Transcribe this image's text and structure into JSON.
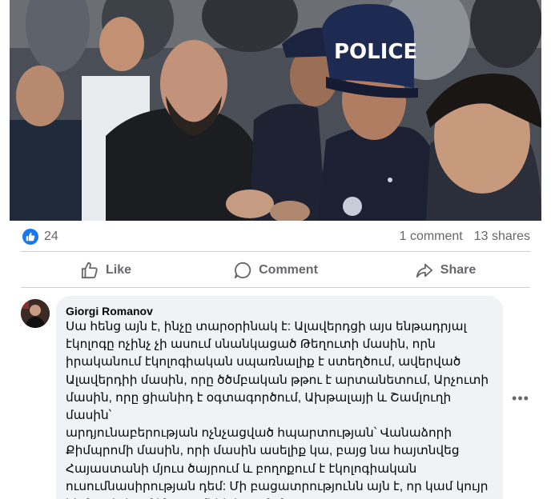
{
  "post": {
    "photo_text": "POLICE",
    "stats": {
      "like_count": "24",
      "comments": "1 comment",
      "shares": "13 shares"
    },
    "actions": {
      "like_label": "Like",
      "comment_label": "Comment",
      "share_label": "Share"
    }
  },
  "comment": {
    "author": "Giorgi Romanov",
    "text": "Սա հենց այն է, ինչը տարօրինակ է: Ալավերդցի այս ենթադրյալ\nէկոլոգը ոչինչ չի ասում սնանկացած Թեղուտի մասին, որն\nիրականում էկոլոգիական սպառնալիք է ստեղծում, ավերված\nԱլավերդիի մասին, որը ծծմբական թթու է արտանետում, Արչուտի\nմասին, որը ցիանիդ է օգտագործում, Ախթալայի և Շամլուղի մասին՝\nարդյունաբերության ոչնչացված հպարտության՝ Վանաձորի\nՔիմպրոմի մասին, որի մասին ասելիք կա, բայց նա հայտնվեց\nՀայաստանի մյուս ծայրում և բողոքում է էկոլոգիական\nուսումնասիրության դեմ: Մի բացատրությունն այն է, որ կամ կույր\nհիմար է, կամ ինչ-որ մեկի հրաման:"
  },
  "colors": {
    "accent": "#1877f2",
    "secondary_text": "#65676b",
    "bubble_bg": "#f0f2f5",
    "divider": "#ced0d4"
  },
  "icons": {
    "like_badge": "thumbs-up-icon",
    "like_action": "thumbs-up-outline-icon",
    "comment_action": "speech-bubble-icon",
    "share_action": "share-arrow-icon",
    "more": "more-options-icon"
  }
}
